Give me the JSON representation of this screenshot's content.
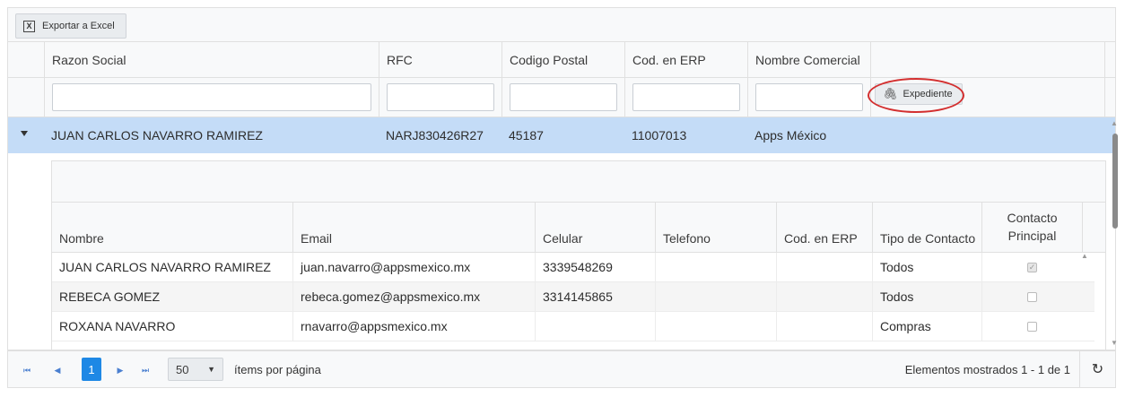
{
  "toolbar": {
    "export_label": "Exportar a Excel",
    "export_icon": "excel-icon"
  },
  "grid": {
    "columns": [
      "Razon Social",
      "RFC",
      "Codigo Postal",
      "Cod. en ERP",
      "Nombre Comercial"
    ],
    "filters": [
      "",
      "",
      "",
      "",
      ""
    ],
    "row": {
      "razon_social": "JUAN CARLOS NAVARRO RAMIREZ",
      "rfc": "NARJ830426R27",
      "codigo_postal": "45187",
      "cod_erp": "11007013",
      "nombre_comercial": "Apps México",
      "expediente_label": "Expediente",
      "expediente_icon": "paperclip-icon"
    },
    "highlight_color": "#d32f2f",
    "selected_row_color": "#c4dcf7"
  },
  "detail": {
    "columns": {
      "nombre": "Nombre",
      "email": "Email",
      "celular": "Celular",
      "telefono": "Telefono",
      "cod_erp": "Cod. en ERP",
      "tipo": "Tipo de Contacto",
      "principal_1": "Contacto",
      "principal_2": "Principal"
    },
    "rows": [
      {
        "nombre": "JUAN CARLOS NAVARRO RAMIREZ",
        "email": "juan.navarro@appsmexico.mx",
        "celular": "3339548269",
        "telefono": "",
        "cod_erp": "",
        "tipo": "Todos",
        "principal": true
      },
      {
        "nombre": "REBECA GOMEZ",
        "email": "rebeca.gomez@appsmexico.mx",
        "celular": "3314145865",
        "telefono": "",
        "cod_erp": "",
        "tipo": "Todos",
        "principal": false
      },
      {
        "nombre": "ROXANA NAVARRO",
        "email": "rnavarro@appsmexico.mx",
        "celular": "",
        "telefono": "",
        "cod_erp": "",
        "tipo": "Compras",
        "principal": false
      }
    ]
  },
  "pager": {
    "current_page": "1",
    "page_size": "50",
    "page_size_label": "ítems por página",
    "count_label": "Elementos mostrados 1 - 1 de 1",
    "accent_color": "#1e88e5"
  }
}
